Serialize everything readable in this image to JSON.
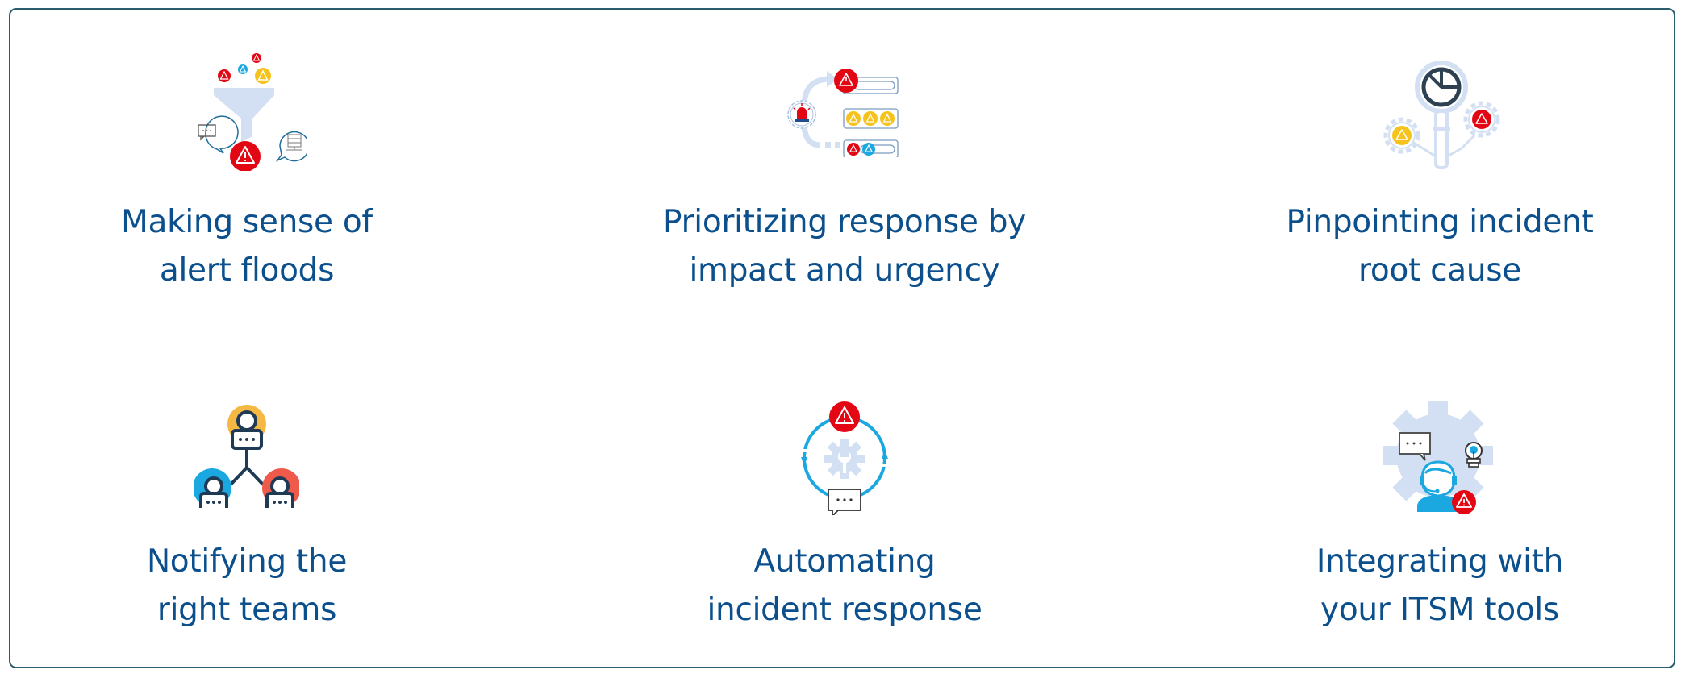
{
  "colors": {
    "title_text": "#0b4f8c",
    "frame_border": "#2b5d6e",
    "alert_red": "#e30613",
    "alert_yellow": "#f6c31c",
    "alert_blue": "#1ba7e0",
    "light_blue": "#d3e0f3",
    "dark_slate": "#2e4152",
    "orange": "#f5b843",
    "coral": "#ef5a4a"
  },
  "features": [
    {
      "id": "alert-floods",
      "icon": "funnel-alerts-icon",
      "title_lines": [
        "Making sense of",
        "alert floods"
      ]
    },
    {
      "id": "prioritizing",
      "icon": "priority-queue-icon",
      "title_lines": [
        "Prioritizing response by",
        "impact and urgency"
      ]
    },
    {
      "id": "root-cause",
      "icon": "magnifier-gears-icon",
      "title_lines": [
        "Pinpointing incident",
        "root cause"
      ]
    },
    {
      "id": "notifying",
      "icon": "team-hierarchy-icon",
      "title_lines": [
        "Notifying the",
        "right teams"
      ]
    },
    {
      "id": "automating",
      "icon": "automation-cycle-icon",
      "title_lines": [
        "Automating",
        "incident response"
      ]
    },
    {
      "id": "itsm",
      "icon": "support-agent-gear-icon",
      "title_lines": [
        "Integrating with",
        "your ITSM tools"
      ]
    }
  ]
}
